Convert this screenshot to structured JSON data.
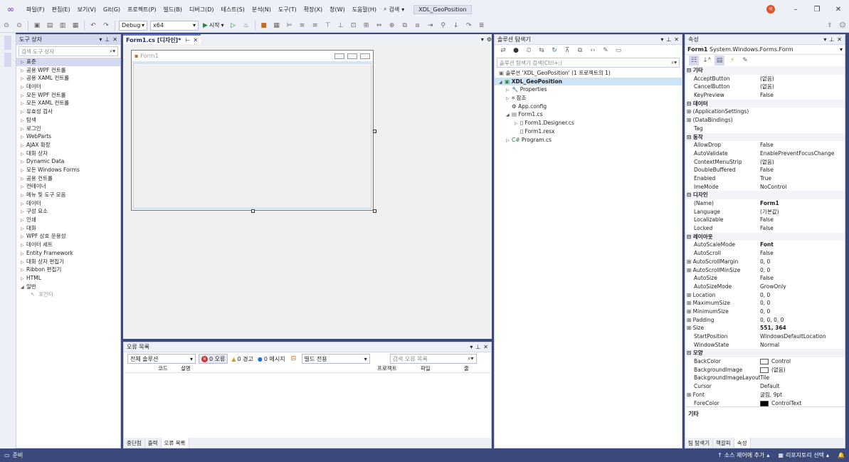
{
  "menu": {
    "items": [
      "파일(F)",
      "편집(E)",
      "보기(V)",
      "Git(G)",
      "프로젝트(P)",
      "빌드(B)",
      "디버그(D)",
      "테스트(S)",
      "분석(N)",
      "도구(T)",
      "확장(X)",
      "창(W)",
      "도움말(H)"
    ],
    "search_label": "검색",
    "project_name": "XDL_GeoPosition",
    "avatar_initials": "VJ"
  },
  "toolbar": {
    "config": "Debug",
    "platform": "x64",
    "start_label": "시작"
  },
  "toolbox": {
    "title": "도구 상자",
    "search_placeholder": "검색 도구 상자",
    "items": [
      "표준",
      "공용 WPF 컨트롤",
      "공용 XAML 컨트롤",
      "데이터",
      "모든 WPF 컨트롤",
      "모든 XAML 컨트롤",
      "유효성 검사",
      "탐색",
      "로그인",
      "WebParts",
      "AJAX 확장",
      "대화 상자",
      "Dynamic Data",
      "모든 Windows Forms",
      "공용 컨트롤",
      "컨테이너",
      "메뉴 및 도구 모음",
      "데이터",
      "구성 요소",
      "인쇄",
      "대화",
      "WPF 상호 운용성",
      "데이터 세트",
      "Entity Framework",
      "대화 상자 편집기",
      "Ribbon 편집기",
      "HTML",
      "일반"
    ],
    "pointer_label": "포인터"
  },
  "designer": {
    "tab_label": "Form1.cs [디자인]*",
    "form_title": "Form1"
  },
  "error_list": {
    "title": "오류 목록",
    "scope": "전체 솔루션",
    "errors_label": "0 오류",
    "warnings_label": "0 경고",
    "messages_label": "0 메시지",
    "build_filter": "빌드 전용",
    "search_placeholder": "검색 오류 목록",
    "columns": [
      "코드",
      "설명",
      "프로젝트",
      "파일",
      "줄"
    ],
    "tabs": [
      "중단점",
      "출력",
      "오류 목록"
    ]
  },
  "solution_explorer": {
    "title": "솔루션 탐색기",
    "search_placeholder": "솔루션 탐색기 검색(Ctrl+;)",
    "solution_label": "솔루션 'XDL_GeoPosition' (1 프로젝트의 1)",
    "project": "XDL_GeoPosition",
    "items": [
      "Properties",
      "참조",
      "App.config",
      "Form1.cs",
      "Form1.Designer.cs",
      "Form1.resx",
      "Program.cs"
    ]
  },
  "properties": {
    "title": "속성",
    "object_name": "Form1",
    "object_type": "System.Windows.Forms.Form",
    "rows": [
      {
        "type": "cat",
        "name": "기타"
      },
      {
        "name": "AcceptButton",
        "value": "(없음)"
      },
      {
        "name": "CancelButton",
        "value": "(없음)"
      },
      {
        "name": "KeyPreview",
        "value": "False"
      },
      {
        "type": "cat",
        "name": "데이터"
      },
      {
        "name": "(ApplicationSettings)",
        "value": "",
        "expand": true
      },
      {
        "name": "(DataBindings)",
        "value": "",
        "expand": true
      },
      {
        "name": "Tag",
        "value": ""
      },
      {
        "type": "cat",
        "name": "동작"
      },
      {
        "name": "AllowDrop",
        "value": "False"
      },
      {
        "name": "AutoValidate",
        "value": "EnablePreventFocusChange"
      },
      {
        "name": "ContextMenuStrip",
        "value": "(없음)"
      },
      {
        "name": "DoubleBuffered",
        "value": "False"
      },
      {
        "name": "Enabled",
        "value": "True"
      },
      {
        "name": "ImeMode",
        "value": "NoControl"
      },
      {
        "type": "cat",
        "name": "디자인"
      },
      {
        "name": "(Name)",
        "value": "Form1",
        "bold": true
      },
      {
        "name": "Language",
        "value": "(기본값)"
      },
      {
        "name": "Localizable",
        "value": "False"
      },
      {
        "name": "Locked",
        "value": "False"
      },
      {
        "type": "cat",
        "name": "레이아웃"
      },
      {
        "name": "AutoScaleMode",
        "value": "Font",
        "bold": true
      },
      {
        "name": "AutoScroll",
        "value": "False"
      },
      {
        "name": "AutoScrollMargin",
        "value": "0, 0",
        "expand": true
      },
      {
        "name": "AutoScrollMinSize",
        "value": "0, 0",
        "expand": true
      },
      {
        "name": "AutoSize",
        "value": "False"
      },
      {
        "name": "AutoSizeMode",
        "value": "GrowOnly"
      },
      {
        "name": "Location",
        "value": "0, 0",
        "expand": true
      },
      {
        "name": "MaximumSize",
        "value": "0, 0",
        "expand": true
      },
      {
        "name": "MinimumSize",
        "value": "0, 0",
        "expand": true
      },
      {
        "name": "Padding",
        "value": "0, 0, 0, 0",
        "expand": true
      },
      {
        "name": "Size",
        "value": "551, 364",
        "expand": true,
        "bold": true
      },
      {
        "name": "StartPosition",
        "value": "WindowsDefaultLocation"
      },
      {
        "name": "WindowState",
        "value": "Normal"
      },
      {
        "type": "cat",
        "name": "모양"
      },
      {
        "name": "BackColor",
        "value": "Control",
        "swatch": "#ffffff"
      },
      {
        "name": "BackgroundImage",
        "value": "(없음)",
        "swatch": "#ffffff"
      },
      {
        "name": "BackgroundImageLayout",
        "value": "Tile"
      },
      {
        "name": "Cursor",
        "value": "Default"
      },
      {
        "name": "Font",
        "value": "굴림, 9pt",
        "expand": true
      },
      {
        "name": "ForeColor",
        "value": "ControlText",
        "swatch": "#000000"
      }
    ],
    "description_title": "기타",
    "tabs": [
      "팀 탐색기",
      "책갈피",
      "속성"
    ]
  },
  "status": {
    "ready": "준비",
    "source_control": "소스 제어에 추가",
    "repo": "리포지토리 선택"
  }
}
